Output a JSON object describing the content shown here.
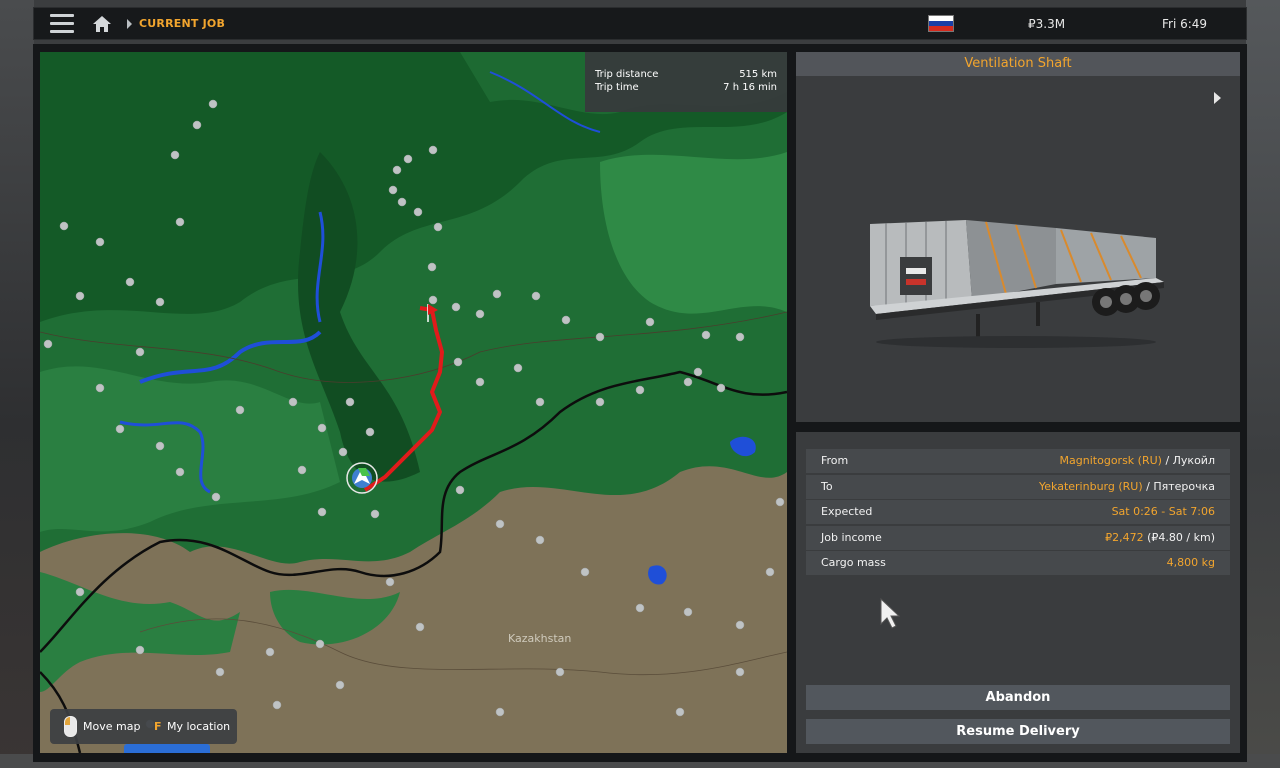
{
  "topbar": {
    "breadcrumb": "CURRENT JOB",
    "money": "₽3.3M",
    "clock": "Fri 6:49",
    "flag_colors": [
      "#ffffff",
      "#1b3fa6",
      "#d52b1e"
    ]
  },
  "trip": {
    "distance_label": "Trip distance",
    "distance_value": "515 km",
    "time_label": "Trip time",
    "time_value": "7 h 16 min"
  },
  "map": {
    "country_label": "Kazakhstan",
    "route_color": "#e11b1b"
  },
  "map_hint": {
    "move_label": "Move map",
    "location_key": "F",
    "location_label": "My location"
  },
  "cargo": {
    "title": "Ventilation Shaft"
  },
  "job": {
    "from_label": "From",
    "from_city": "Magnitogorsk (RU)",
    "from_company": " / Лукойл",
    "to_label": "To",
    "to_city": "Yekaterinburg (RU)",
    "to_company": " / Пятерочка",
    "expected_label": "Expected",
    "expected_value": "Sat 0:26 - Sat 7:06",
    "income_label": "Job income",
    "income_value": "₽2,472",
    "income_rate": " (₽4.80 / km)",
    "mass_label": "Cargo mass",
    "mass_value": "4,800 kg"
  },
  "actions": {
    "abandon": "Abandon",
    "resume": "Resume Delivery"
  },
  "accent_color": "#f2a52e"
}
